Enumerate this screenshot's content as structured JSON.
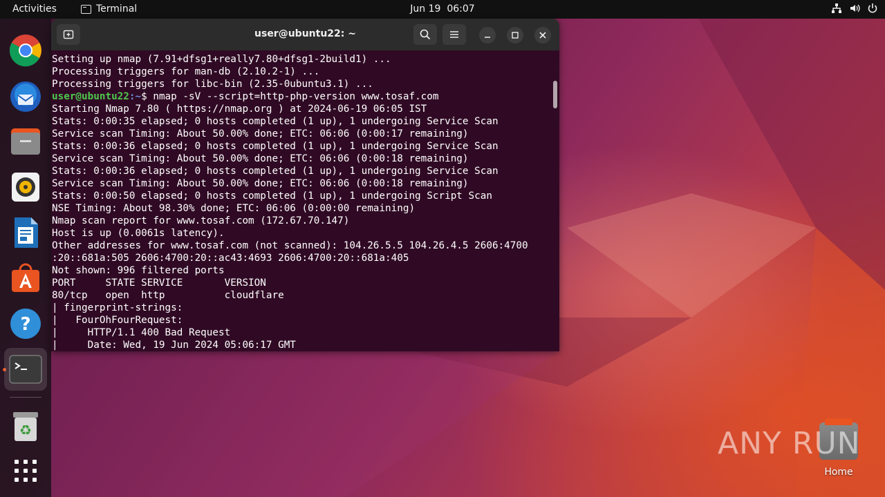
{
  "topbar": {
    "activities": "Activities",
    "app_name": "Terminal",
    "date": "Jun 19",
    "time": "06:07"
  },
  "dock": {
    "items": [
      {
        "name": "chrome"
      },
      {
        "name": "thunderbird"
      },
      {
        "name": "files"
      },
      {
        "name": "rhythmbox"
      },
      {
        "name": "libreoffice-writer"
      },
      {
        "name": "app-center"
      },
      {
        "name": "help"
      },
      {
        "name": "terminal"
      },
      {
        "name": "trash"
      },
      {
        "name": "show-apps"
      }
    ]
  },
  "terminal": {
    "title": "user@ubuntu22: ~",
    "prompt_user": "user@ubuntu22",
    "prompt_path": ":~",
    "prompt_symbol": "$ ",
    "command": "nmap -sV --script=http-php-version www.tosaf.com",
    "lines_before": [
      "Setting up nmap (7.91+dfsg1+really7.80+dfsg1-2build1) ...",
      "Processing triggers for man-db (2.10.2-1) ...",
      "Processing triggers for libc-bin (2.35-0ubuntu3.1) ..."
    ],
    "lines_after": [
      "Starting Nmap 7.80 ( https://nmap.org ) at 2024-06-19 06:05 IST",
      "Stats: 0:00:35 elapsed; 0 hosts completed (1 up), 1 undergoing Service Scan",
      "Service scan Timing: About 50.00% done; ETC: 06:06 (0:00:17 remaining)",
      "Stats: 0:00:36 elapsed; 0 hosts completed (1 up), 1 undergoing Service Scan",
      "Service scan Timing: About 50.00% done; ETC: 06:06 (0:00:18 remaining)",
      "Stats: 0:00:36 elapsed; 0 hosts completed (1 up), 1 undergoing Service Scan",
      "Service scan Timing: About 50.00% done; ETC: 06:06 (0:00:18 remaining)",
      "Stats: 0:00:50 elapsed; 0 hosts completed (1 up), 1 undergoing Script Scan",
      "NSE Timing: About 98.30% done; ETC: 06:06 (0:00:00 remaining)",
      "Nmap scan report for www.tosaf.com (172.67.70.147)",
      "Host is up (0.0061s latency).",
      "Other addresses for www.tosaf.com (not scanned): 104.26.5.5 104.26.4.5 2606:4700",
      ":20::681a:505 2606:4700:20::ac43:4693 2606:4700:20::681a:405",
      "Not shown: 996 filtered ports",
      "PORT     STATE SERVICE       VERSION",
      "80/tcp   open  http          cloudflare",
      "| fingerprint-strings:",
      "|   FourOhFourRequest:",
      "|     HTTP/1.1 400 Bad Request",
      "|     Date: Wed, 19 Jun 2024 05:06:17 GMT"
    ]
  },
  "desktop": {
    "home_label": "Home",
    "watermark": "ANY RUN"
  },
  "colors": {
    "terminal_bg": "#300a24",
    "prompt_user": "#4ec94e",
    "prompt_path": "#6a8fd8",
    "accent": "#e95420"
  }
}
